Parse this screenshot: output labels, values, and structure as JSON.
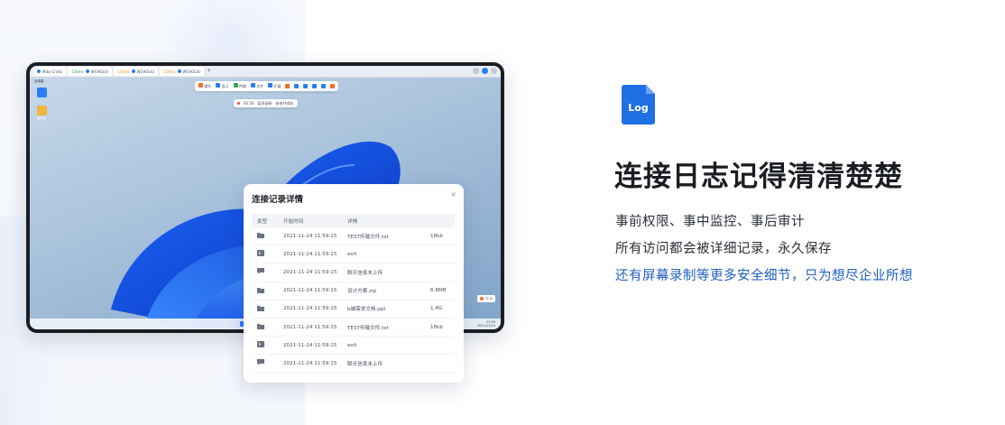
{
  "remote_desktop": {
    "tabs": [
      {
        "label": "Mike Cristo",
        "status": "",
        "status_class": ""
      },
      {
        "label": "WCHOLIU",
        "status": "126ms",
        "status_class": "ok"
      },
      {
        "label": "WCHOLIU",
        "status": "126ms",
        "status_class": "warn"
      },
      {
        "label": "WCHOLIU",
        "status": "126ms",
        "status_class": "warn"
      }
    ],
    "tab_add": "+",
    "toolbar": {
      "items": [
        "操作",
        "显示",
        "传输",
        "文件",
        "扩展"
      ],
      "icon_colors": [
        "#f36b2b",
        "#2a7cf7",
        "#3aa655",
        "#2a7cf7",
        "#2a7cf7",
        "#f36b2b",
        "#2a7cf7",
        "#2a7cf7",
        "#2a7cf7",
        "#2a7cf7",
        "#f36b2b"
      ]
    },
    "record_bar": {
      "time": "00:56",
      "pause": "暂停录制",
      "stop": "结束并保存"
    },
    "desktop_icons": [
      {
        "label": "此电脑",
        "color": "#2a7cf7"
      },
      {
        "label": "回收站",
        "color": "#f2b43a"
      }
    ],
    "tray_badge": "中 ⚙",
    "clock": {
      "time": "11:59",
      "date": "2021/11/24"
    }
  },
  "modal": {
    "title": "连接记录详情",
    "close": "×",
    "columns": [
      "类型",
      "开始时间",
      "详情",
      ""
    ],
    "rows": [
      {
        "icon": "folder-icon",
        "time": "2021-11-24 11:59:15",
        "detail": "TEST传输文件.txt",
        "size": "18kb"
      },
      {
        "icon": "terminal-icon",
        "time": "2021-11-24 11:59:15",
        "detail": "exit",
        "size": ""
      },
      {
        "icon": "chat-icon",
        "time": "2021-11-24 11:59:15",
        "detail": "聊天信息未上传",
        "size": ""
      },
      {
        "icon": "folder-icon",
        "time": "2021-11-24 11:59:15",
        "detail": "设计方案.zip",
        "size": "6.8MB"
      },
      {
        "icon": "folder-icon",
        "time": "2021-11-24 11:59:15",
        "detail": "b端需求文档.ppt",
        "size": "1.4G"
      },
      {
        "icon": "folder-icon",
        "time": "2021-11-24 11:59:15",
        "detail": "TEST传输文件.txt",
        "size": "18kb"
      },
      {
        "icon": "terminal-icon",
        "time": "2021-11-24 11:59:15",
        "detail": "exit",
        "size": ""
      },
      {
        "icon": "chat-icon",
        "time": "2021-11-24 11:59:15",
        "detail": "聊天信息未上传",
        "size": ""
      }
    ]
  },
  "feature": {
    "badge_text": "Log",
    "badge_color": "#1f6fe5",
    "headline": "连接日志记得清清楚楚",
    "line1": "事前权限、事中监控、事后审计",
    "line2": "所有访问都会被详细记录，永久保存",
    "line3": "还有屏幕录制等更多安全细节，只为想尽企业所想"
  }
}
